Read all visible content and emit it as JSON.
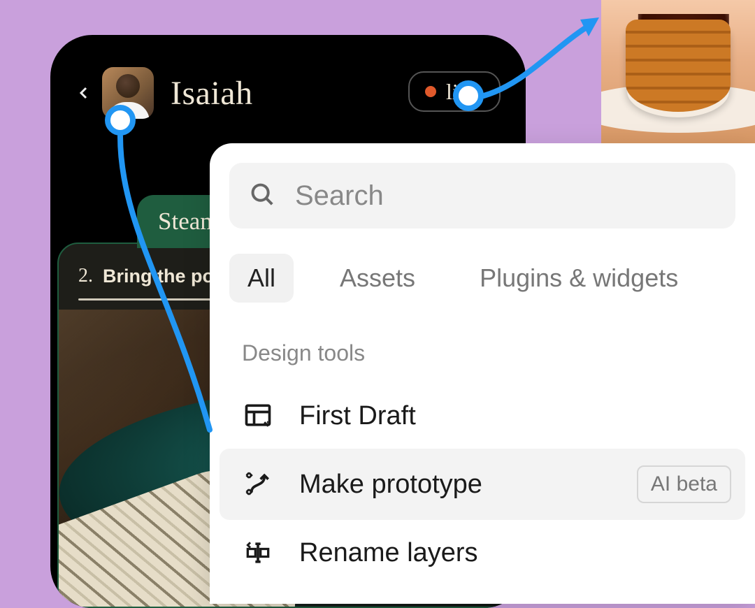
{
  "phone": {
    "user_name": "Isaiah",
    "live_label": "live",
    "tab_label": "Steam",
    "step_number": "2.",
    "step_text": "Bring the pot o"
  },
  "popover": {
    "search_placeholder": "Search",
    "tabs": {
      "all": "All",
      "assets": "Assets",
      "plugins": "Plugins & widgets"
    },
    "section_label": "Design tools",
    "tools": {
      "first_draft": "First Draft",
      "make_prototype": "Make prototype",
      "rename_layers": "Rename layers"
    },
    "ai_beta_badge": "AI beta"
  }
}
